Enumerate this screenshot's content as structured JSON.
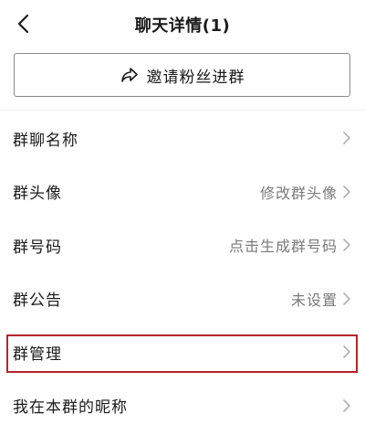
{
  "nav": {
    "title": "聊天详情(1)",
    "back_icon": "chevron-left-icon"
  },
  "invite": {
    "label": "邀请粉丝进群",
    "icon": "share-icon"
  },
  "rows": [
    {
      "label": "群聊名称",
      "value": ""
    },
    {
      "label": "群头像",
      "value": "修改群头像"
    },
    {
      "label": "群号码",
      "value": "点击生成群号码"
    },
    {
      "label": "群公告",
      "value": "未设置"
    },
    {
      "label": "群管理",
      "value": ""
    },
    {
      "label": "我在本群的昵称",
      "value": ""
    }
  ],
  "colors": {
    "highlight": "#b5242a",
    "secondary_text": "#7a7a7a",
    "chevron": "#b0b0b0"
  }
}
